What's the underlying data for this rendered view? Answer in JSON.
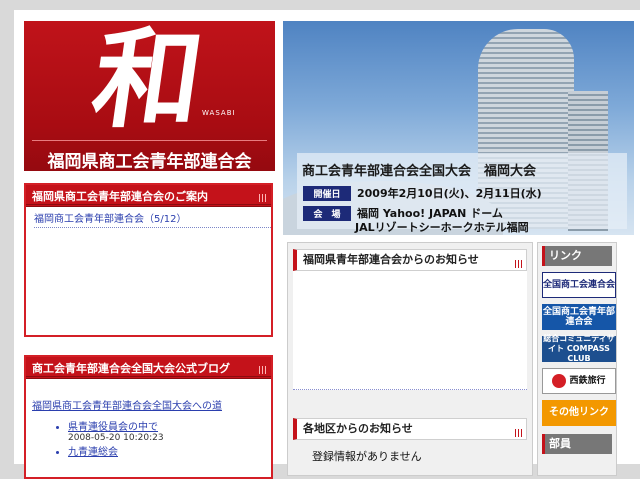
{
  "logo": {
    "brush_char": "和",
    "small_text": "WASABI",
    "title": "福岡県商工会青年部連合会"
  },
  "hero": {
    "event_title": "商工会青年部連合会全国大会　福岡大会",
    "date_tag": "開催日",
    "date_value": "2009年2月10日(火)、2月11日(水)",
    "venue_tag": "会　場",
    "venue_line1": "福岡 Yahoo! JAPAN ドーム",
    "venue_line2": "JALリゾートシーホークホテル福岡"
  },
  "box1": {
    "header": "福岡県商工会青年部連合会のご案内",
    "items": [
      "福岡商工会青年部連合会（5/12）"
    ]
  },
  "box2": {
    "header": "商工会青年部連合会全国大会公式ブログ",
    "lead": "福岡県商工会青年部連合会全国大会への道",
    "posts": [
      {
        "title": "県青連役員会の中で",
        "date": "2008-05-20 10:20:23"
      },
      {
        "title": "九青連総会",
        "date": ""
      }
    ]
  },
  "news": {
    "header1": "福岡県青年部連合会からのお知らせ",
    "header2": "各地区からのお知らせ",
    "empty_text": "登録情報がありません"
  },
  "links": {
    "header": "リンク",
    "buttons": [
      {
        "label": "全国商工会連合会"
      },
      {
        "label": "全国商工会青年部連合会"
      },
      {
        "label": "総合コミュニティサイト COMPASS CLUB"
      },
      {
        "label": "西鉄旅行"
      },
      {
        "label": "その他リンク"
      }
    ],
    "header2": "部員"
  },
  "colors": {
    "brand_red": "#c4121a",
    "link_blue": "#2b3fae",
    "navy": "#1d2a78",
    "orange": "#f39800"
  }
}
